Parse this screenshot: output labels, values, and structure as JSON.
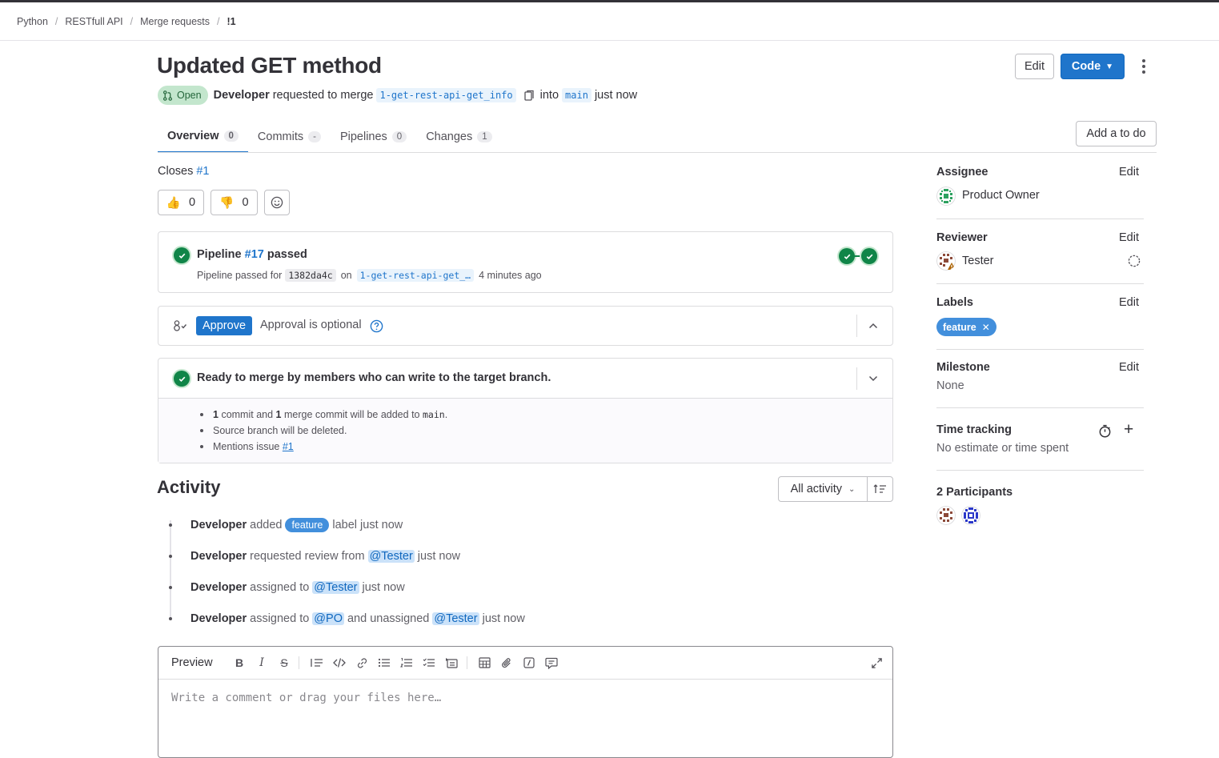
{
  "breadcrumb": {
    "items": [
      "Python",
      "RESTfull API",
      "Merge requests"
    ],
    "current": "!1"
  },
  "mr": {
    "title": "Updated GET method",
    "status": "Open",
    "author": "Developer",
    "requested_text": "requested to merge",
    "source_branch": "1-get-rest-api-get_info",
    "into_text": "into",
    "target_branch": "main",
    "time": "just now"
  },
  "header": {
    "edit_label": "Edit",
    "code_label": "Code",
    "code_chevron": "⌄"
  },
  "tabs": [
    {
      "label": "Overview",
      "count": "0"
    },
    {
      "label": "Commits",
      "count": "-"
    },
    {
      "label": "Pipelines",
      "count": "0"
    },
    {
      "label": "Changes",
      "count": "1"
    }
  ],
  "todo_label": "Add a to do",
  "closes": {
    "text": "Closes",
    "issue": "#1"
  },
  "reactions": {
    "thumbs_up": "👍",
    "thumbs_up_count": "0",
    "thumbs_down": "👎",
    "thumbs_down_count": "0"
  },
  "pipeline": {
    "label": "Pipeline",
    "id": "#17",
    "status": "passed",
    "sub_text": "Pipeline passed for",
    "sha": "1382da4c",
    "on_text": "on",
    "branch": "1-get-rest-api-get_…",
    "time": "4 minutes ago"
  },
  "approval": {
    "button": "Approve",
    "text": "Approval is optional"
  },
  "merge": {
    "title": "Ready to merge by members who can write to the target branch.",
    "items": {
      "commits_a": "1",
      "commits_b": "commit and",
      "commits_c": "1",
      "commits_d": "merge commit will be added to",
      "commits_target": "main",
      "source_deleted": "Source branch will be deleted.",
      "mentions_text": "Mentions issue",
      "mentions_issue": "#1"
    }
  },
  "activity": {
    "title": "Activity",
    "filter_label": "All activity",
    "notes": [
      {
        "author": "Developer",
        "a": "added",
        "label": "feature",
        "b": "label just now"
      },
      {
        "author": "Developer",
        "a": "requested review from",
        "mention": "@Tester",
        "b": "just now"
      },
      {
        "author": "Developer",
        "a": "assigned to",
        "mention": "@Tester",
        "b": "just now"
      },
      {
        "author": "Developer",
        "a": "assigned to",
        "mention": "@PO",
        "b": "and unassigned",
        "mention2": "@Tester",
        "c": "just now"
      }
    ]
  },
  "editor": {
    "preview_label": "Preview",
    "placeholder": "Write a comment or drag your files here…"
  },
  "sidebar": {
    "assignee": {
      "title": "Assignee",
      "edit": "Edit",
      "name": "Product Owner"
    },
    "reviewer": {
      "title": "Reviewer",
      "edit": "Edit",
      "name": "Tester"
    },
    "labels": {
      "title": "Labels",
      "edit": "Edit",
      "label": "feature",
      "remove": "✕"
    },
    "milestone": {
      "title": "Milestone",
      "edit": "Edit",
      "value": "None"
    },
    "time_tracking": {
      "title": "Time tracking",
      "value": "No estimate or time spent",
      "add": "+"
    },
    "participants": {
      "title": "2 Participants"
    }
  },
  "colors": {
    "accent": "#1f75cb",
    "success": "#108548",
    "label": "#428fdc",
    "open_bg": "#c3e6cd"
  }
}
